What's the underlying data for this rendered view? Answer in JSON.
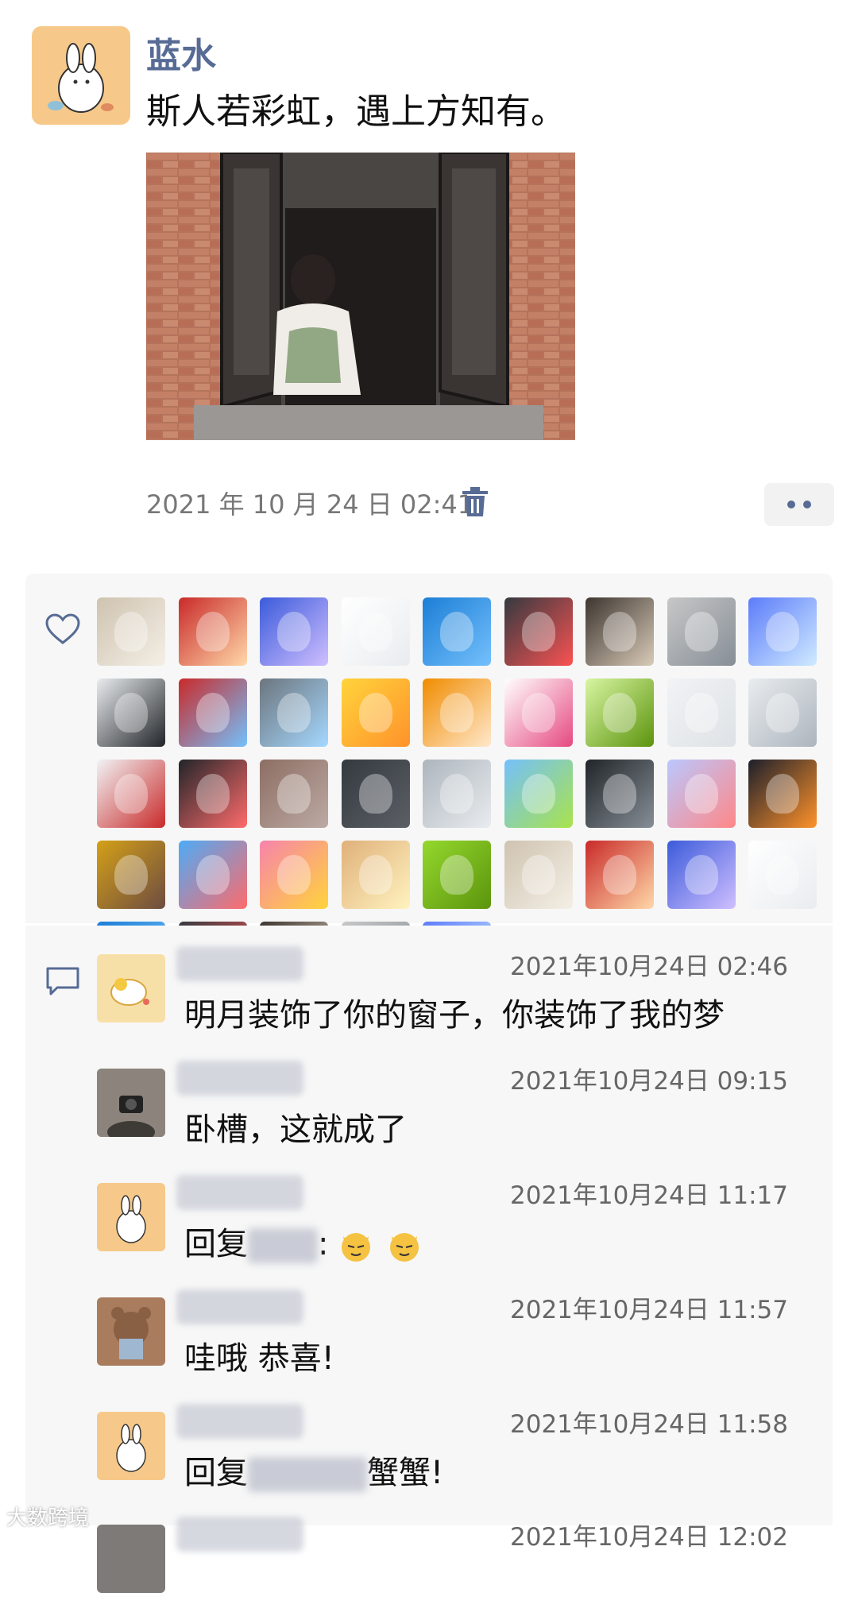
{
  "post": {
    "author": "蓝水",
    "text": "斯人若彩虹，遇上方知有。",
    "timestamp": "2021 年 10 月 24 日 02:41"
  },
  "likes": {
    "count": 41
  },
  "comments": [
    {
      "time": "2021年10月24日 02:46",
      "text": "明月装饰了你的窗子，你装饰了我的梦"
    },
    {
      "time": "2021年10月24日 09:15",
      "text": "卧槽，这就成了"
    },
    {
      "time": "2021年10月24日 11:17",
      "prefix": "回复",
      "suffix": ":",
      "emoji": [
        "cat-emoji",
        "cat-emoji"
      ]
    },
    {
      "time": "2021年10月24日 11:57",
      "text": "哇哦  恭喜!"
    },
    {
      "time": "2021年10月24日 11:58",
      "prefix": "回复",
      "suffix": "蟹蟹!"
    },
    {
      "time": "2021年10月24日 12:02"
    }
  ],
  "watermark": "大数跨境",
  "colors": {
    "accent": "#576b95",
    "panel": "#f7f7f7",
    "time": "#777777"
  }
}
